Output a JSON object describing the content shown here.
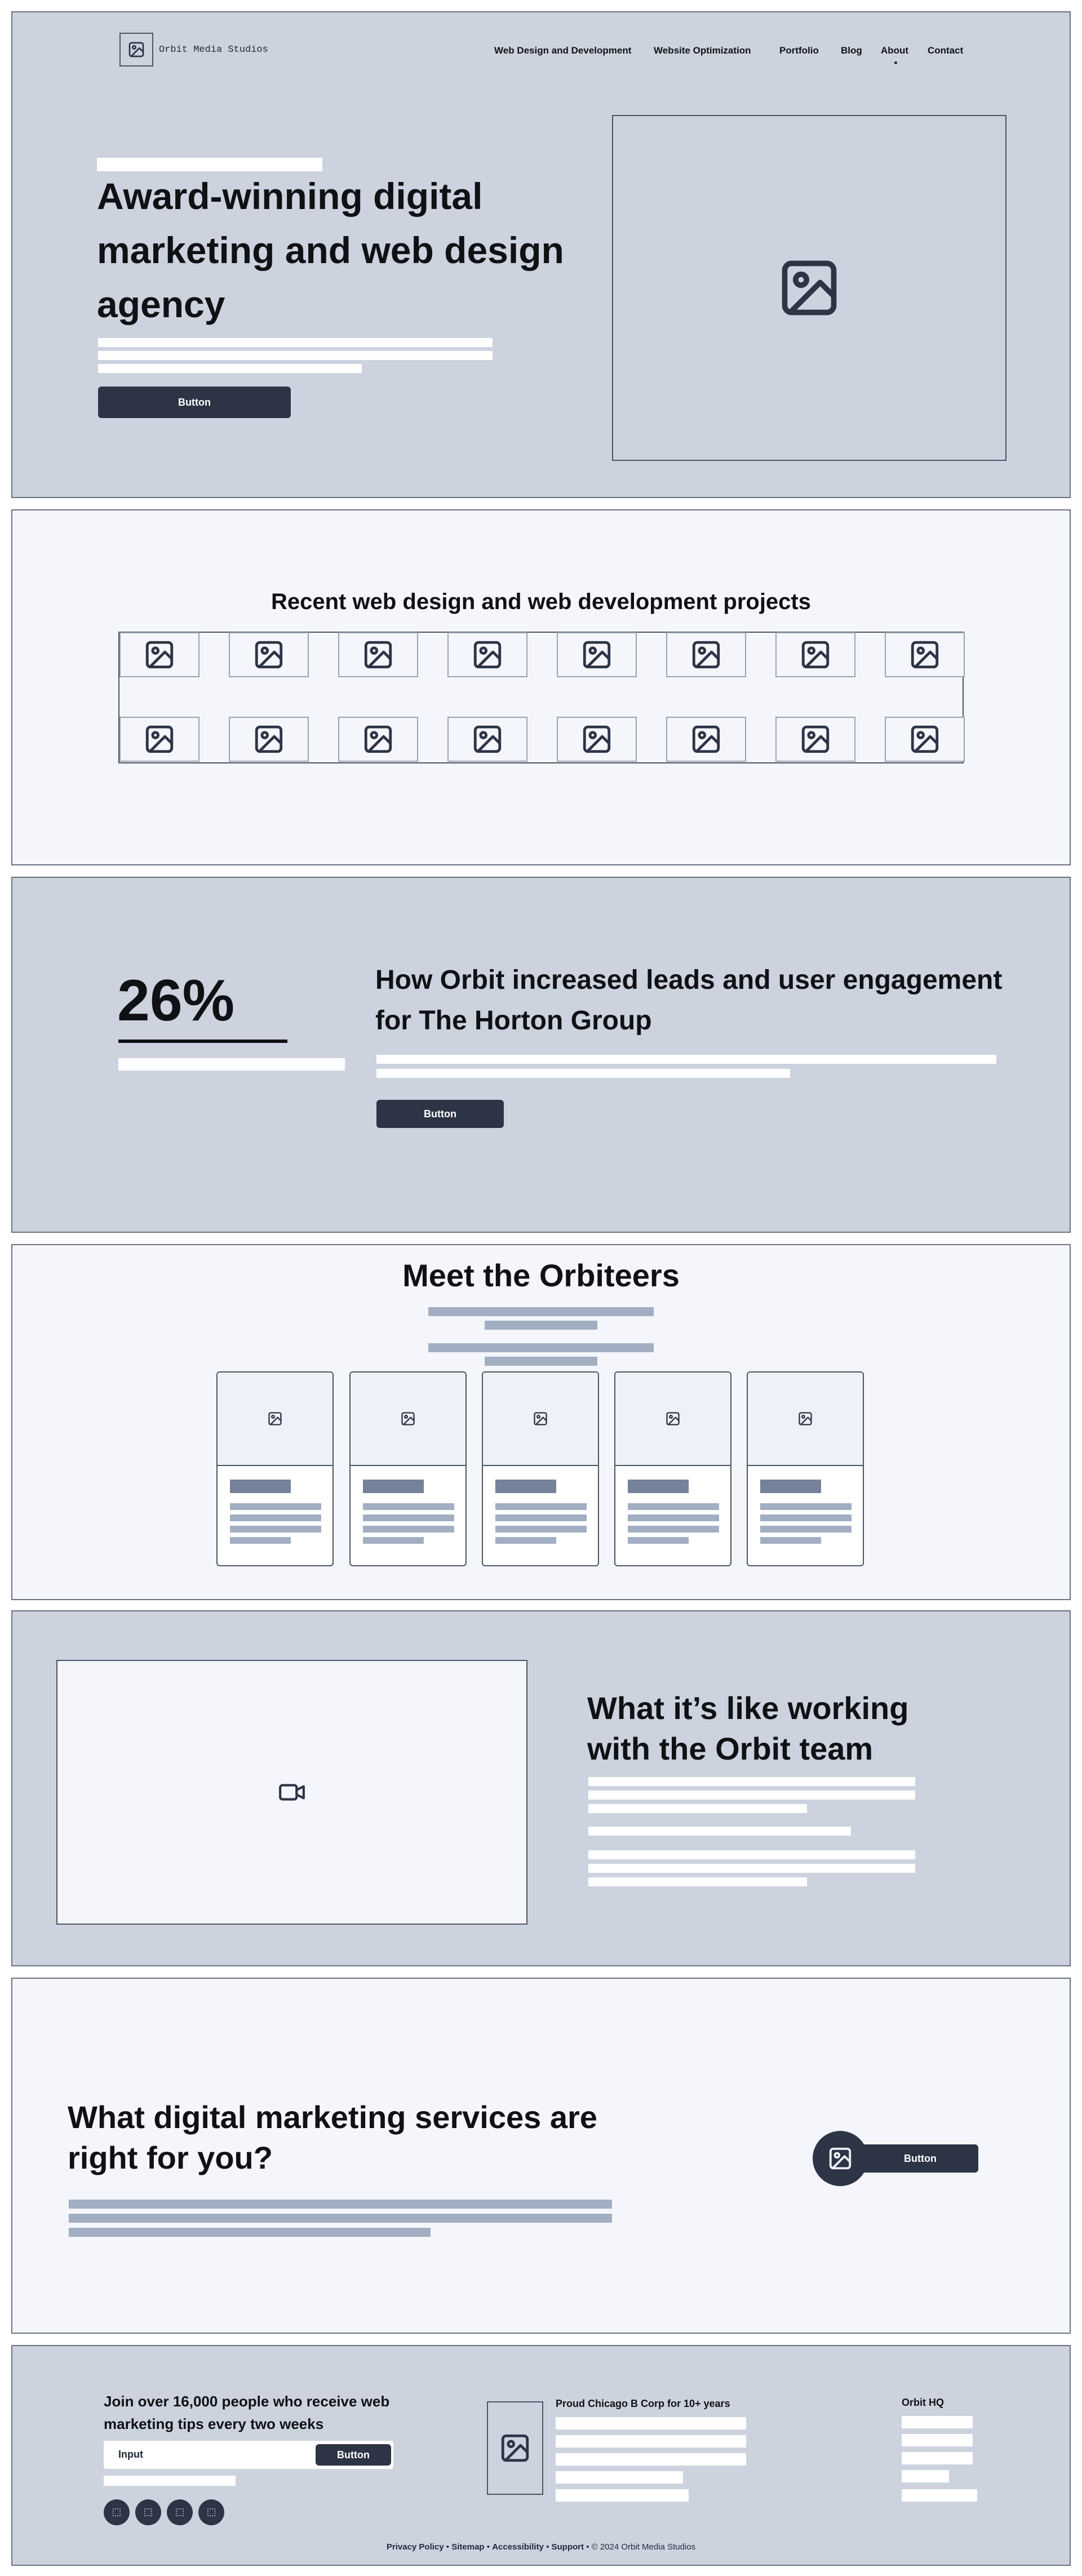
{
  "header": {
    "brand": "Orbit Media Studios",
    "nav": [
      "Web Design and Development",
      "Website Optimization",
      "Portfolio",
      "Blog",
      "About",
      "Contact"
    ]
  },
  "hero": {
    "title_lines": [
      "Award-winning digital",
      "marketing and web design",
      "agency"
    ],
    "button": "Button",
    "image_icon": "image-icon"
  },
  "projects": {
    "title": "Recent web design and web development projects",
    "icon": "image-icon"
  },
  "case_study": {
    "stat": "26%",
    "title_lines": [
      "How Orbit increased leads and user engagement",
      "for The Horton Group"
    ],
    "button": "Button"
  },
  "team": {
    "title": "Meet the Orbiteers",
    "card_icon": "image-icon"
  },
  "video": {
    "icon": "video-camera-icon",
    "title_lines": [
      "What it’s like working",
      "with the Orbit team"
    ]
  },
  "cta": {
    "title_lines": [
      "What digital marketing services are",
      "right for you?"
    ],
    "button": "Button",
    "icon": "image-icon"
  },
  "footer": {
    "newsletter_lines": [
      "Join over 16,000 people who receive web",
      "marketing tips every two weeks"
    ],
    "input_placeholder": "Input",
    "input_button": "Button",
    "bcorp": "Proud Chicago B Corp for 10+ years",
    "hq": "Orbit HQ",
    "links": [
      "Privacy Policy",
      "Sitemap",
      "Accessibility",
      "Support"
    ],
    "separator": "•",
    "copyright": "© 2024 Orbit Media Studios"
  },
  "colors": {
    "dark_section": "#ccd3df",
    "light_section": "#f4f6fb",
    "button": "#2d3446",
    "border": "#6b7280"
  }
}
